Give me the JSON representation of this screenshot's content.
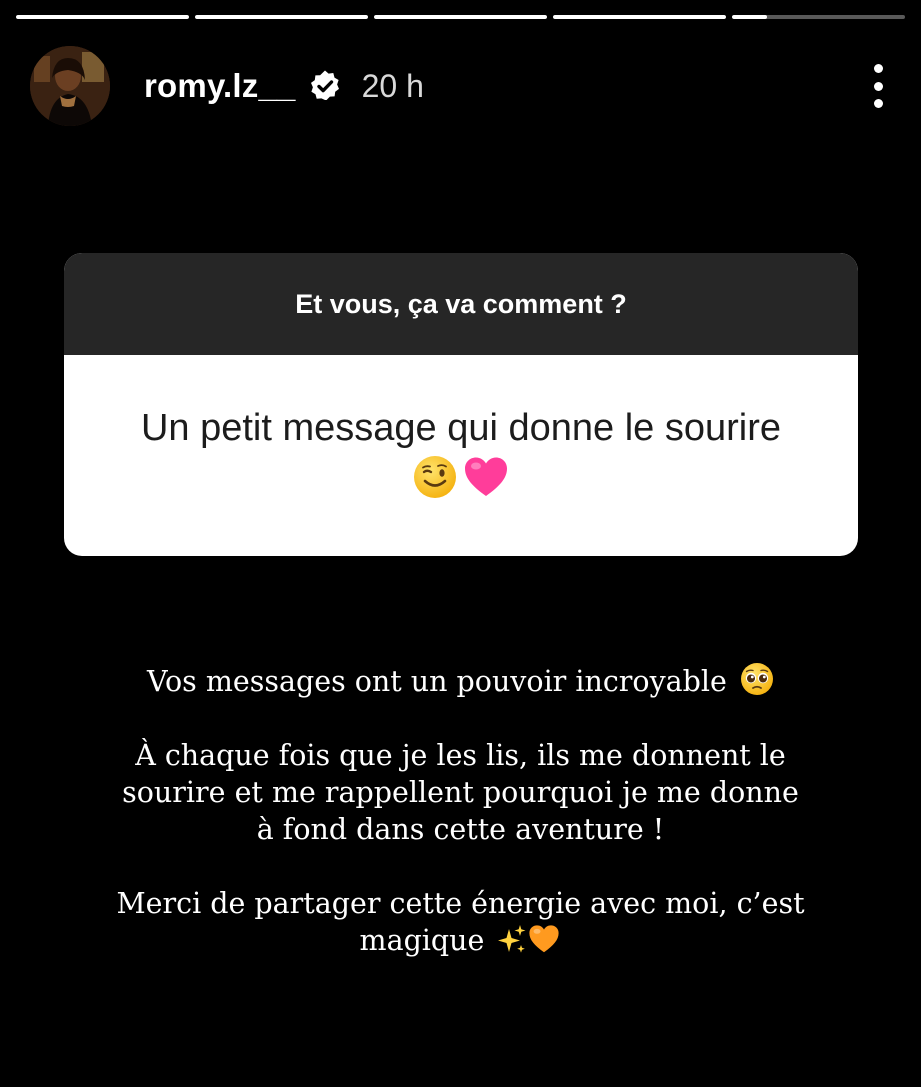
{
  "story": {
    "segments": 5,
    "progress": [
      1,
      1,
      1,
      1,
      0.2
    ]
  },
  "header": {
    "username": "romy.lz__",
    "time": "20 h",
    "verified": true,
    "avatar_icon": "profile-photo",
    "more_icon": "vertical-dots-icon"
  },
  "sticker": {
    "question": "Et vous, ça va comment ?",
    "answer": "Un petit message qui donne le sourire",
    "answer_emojis": [
      "winking-face-emoji",
      "pink-heart-emoji"
    ]
  },
  "caption": {
    "line1": "Vos messages ont un pouvoir incroyable",
    "line1_emoji": "pleading-face-emoji",
    "para2_l1": "À chaque fois que je les lis, ils me donnent le",
    "para2_l2": "sourire et me rappellent pourquoi je me donne",
    "para2_l3": "à fond dans cette aventure !",
    "para3_l1": "Merci de partager cette énergie avec moi, c’est",
    "para3_l2": "magique",
    "para3_emojis": [
      "sparkles-emoji",
      "orange-heart-emoji"
    ]
  },
  "colors": {
    "background": "#000000",
    "sticker_header": "#262626",
    "sticker_body": "#ffffff",
    "text": "#ffffff"
  }
}
